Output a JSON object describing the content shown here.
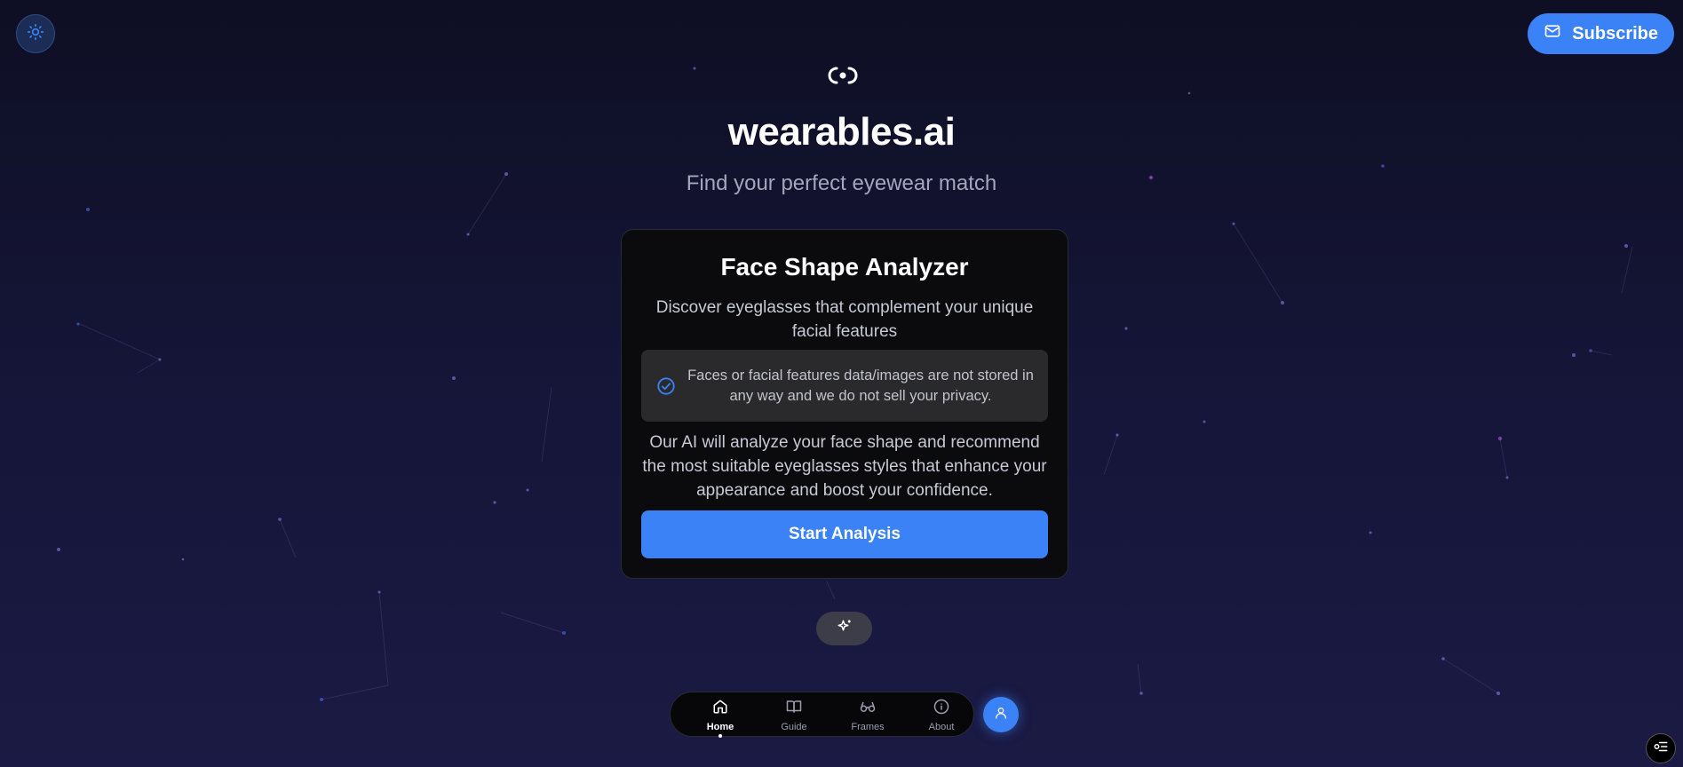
{
  "header": {
    "theme_toggle_icon": "sun-icon",
    "subscribe_label": "Subscribe",
    "subscribe_icon": "mail-icon"
  },
  "brand": {
    "logo_icon": "eyewear-logo-icon",
    "name": "wearables.ai",
    "tagline": "Find your perfect eyewear match"
  },
  "card": {
    "title": "Face Shape Analyzer",
    "description": "Discover eyeglasses that complement your unique facial features",
    "privacy_notice": "Faces or facial features data/images are not stored in any way and we do not sell your privacy.",
    "ai_description": "Our AI will analyze your face shape and recommend the most suitable eyeglasses styles that enhance your appearance and boost your confidence.",
    "start_button_label": "Start Analysis"
  },
  "sparkle_icon": "sparkle-icon",
  "bottom_nav": {
    "items": [
      {
        "label": "Home",
        "icon": "home-icon",
        "active": true
      },
      {
        "label": "Guide",
        "icon": "book-icon",
        "active": false
      },
      {
        "label": "Frames",
        "icon": "glasses-icon",
        "active": false
      },
      {
        "label": "About",
        "icon": "info-icon",
        "active": false
      }
    ],
    "profile_icon": "user-icon"
  },
  "corner_menu_icon": "menu-settings-icon",
  "colors": {
    "accent": "#3b82f6",
    "background_top": "#0e0f24",
    "background_bottom": "#1a1a44",
    "card_bg": "#0b0b0d",
    "notice_bg": "#2a2a2c"
  }
}
